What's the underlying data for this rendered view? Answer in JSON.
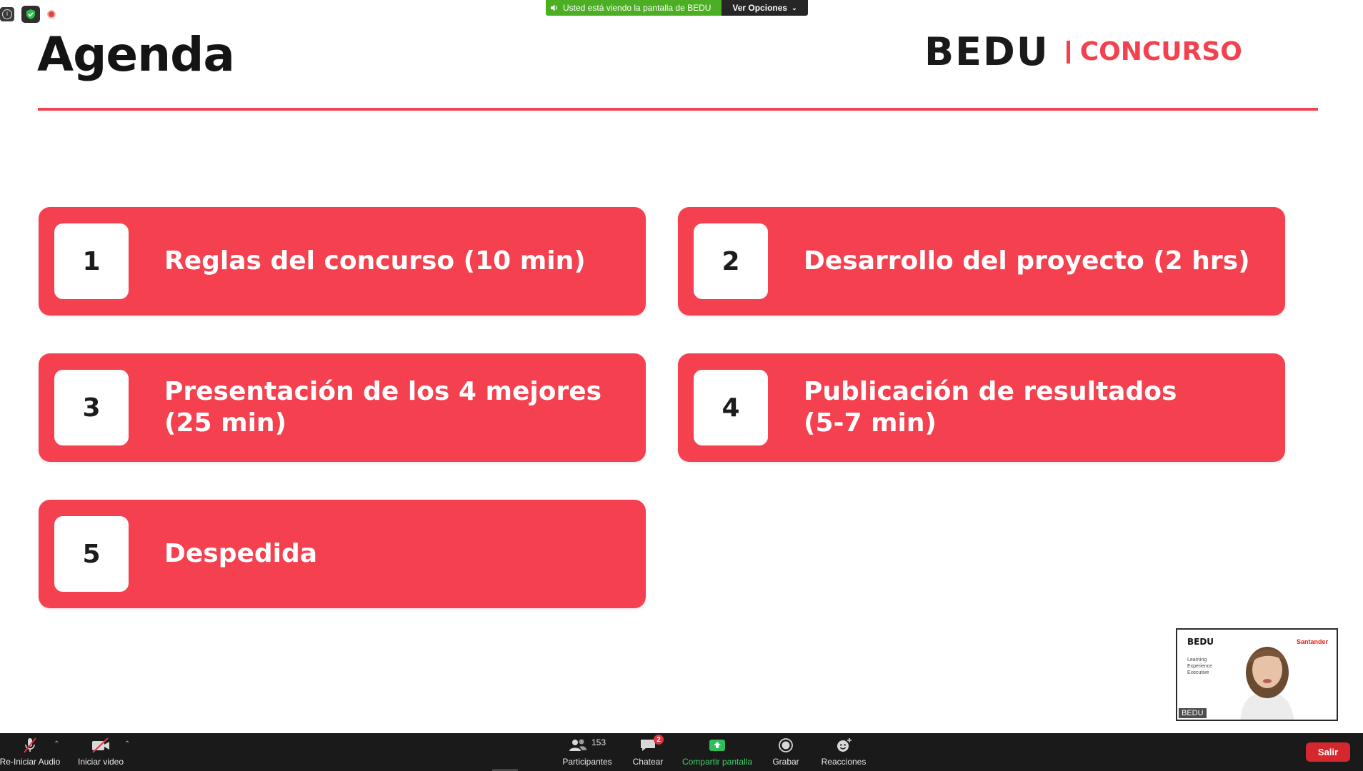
{
  "share_banner": {
    "status_text": "Usted está viendo la pantalla de BEDU",
    "options_label": "Ver Opciones"
  },
  "slide": {
    "title": "Agenda",
    "brand_logo": "BEDU",
    "brand_contest": "CONCURSO",
    "accent_color": "#f5404f",
    "agenda": [
      {
        "number": "1",
        "text": "Reglas del concurso  (10 min)"
      },
      {
        "number": "2",
        "text": "Desarrollo del proyecto (2 hrs)"
      },
      {
        "number": "3",
        "text": "Presentación de los 4 mejores\n(25 min)"
      },
      {
        "number": "4",
        "text": "Publicación de resultados\n(5-7 min)"
      },
      {
        "number": "5",
        "text": "Despedida"
      }
    ]
  },
  "video_thumb": {
    "logo": "BEDU",
    "subtitle": "Learning\nExperience\nExecutive",
    "sponsor": "Santander",
    "participant_name": "BEDU"
  },
  "toolbar": {
    "audio_label": "Re-Iniciar Audio",
    "video_label": "Iniciar video",
    "participants_label": "Participantes",
    "participants_count": "153",
    "chat_label": "Chatear",
    "chat_badge": "2",
    "share_label": "Compartir pantalla",
    "record_label": "Grabar",
    "reactions_label": "Reacciones",
    "end_label": "Salir"
  }
}
